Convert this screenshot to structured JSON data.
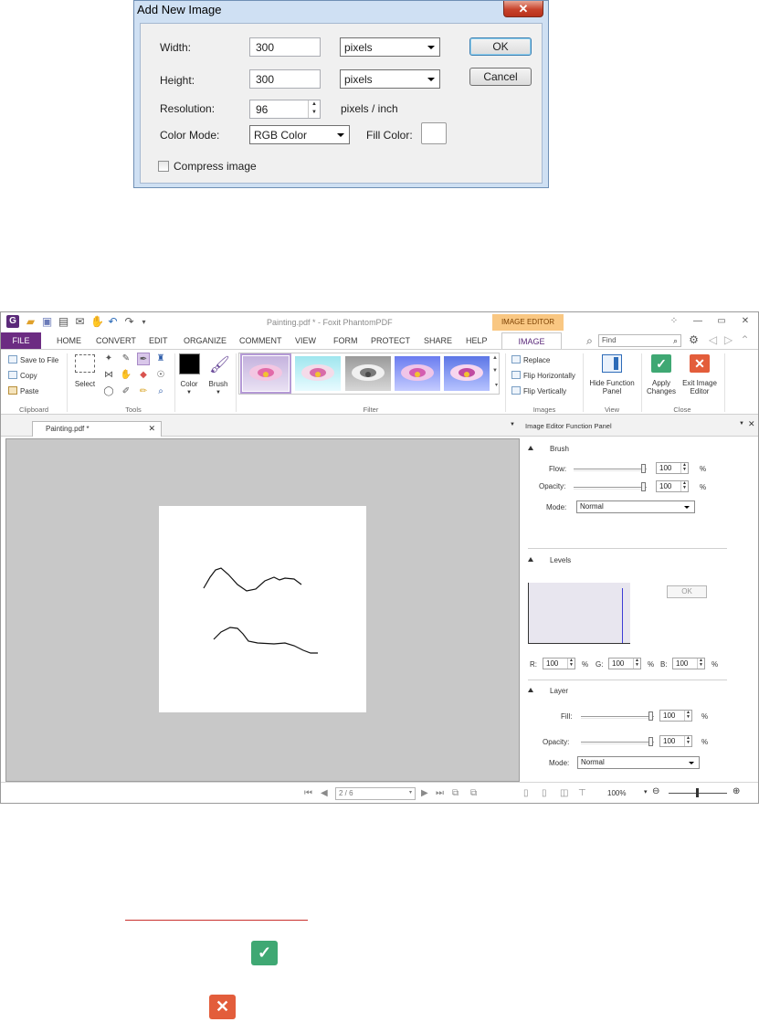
{
  "dialog": {
    "title": "Add New Image",
    "close_glyph": "✕",
    "width_label": "Width:",
    "width_value": "300",
    "width_unit": "pixels",
    "height_label": "Height:",
    "height_value": "300",
    "height_unit": "pixels",
    "resolution_label": "Resolution:",
    "resolution_value": "96",
    "resolution_unit": "pixels / inch",
    "color_mode_label": "Color Mode:",
    "color_mode_value": "RGB Color",
    "fill_color_label": "Fill Color:",
    "fill_color": "#ffffff",
    "compress_label": "Compress image",
    "compress_checked": false,
    "ok_label": "OK",
    "cancel_label": "Cancel"
  },
  "app": {
    "window_title": "Painting.pdf * - Foxit PhantomPDF",
    "context_tab_header": "IMAGE EDITOR",
    "tabs": [
      "FILE",
      "HOME",
      "CONVERT",
      "EDIT",
      "ORGANIZE",
      "COMMENT",
      "VIEW",
      "FORM",
      "PROTECT",
      "SHARE",
      "HELP",
      "IMAGE"
    ],
    "active_tab": "IMAGE",
    "find_placeholder": "Find",
    "ribbon": {
      "clipboard": {
        "label": "Clipboard",
        "save_to_file": "Save to File",
        "copy": "Copy",
        "paste": "Paste"
      },
      "tools": {
        "label": "Tools",
        "select": "Select"
      },
      "color_label": "Color",
      "brush_label": "Brush",
      "filter_label": "Filter",
      "images": {
        "label": "Images",
        "replace": "Replace",
        "flip_horizontally": "Flip Horizontally",
        "flip_vertically": "Flip Vertically"
      },
      "view": {
        "label": "View",
        "hide_function_panel_1": "Hide Function",
        "hide_function_panel_2": "Panel"
      },
      "close": {
        "label": "Close",
        "apply_1": "Apply",
        "apply_2": "Changes",
        "exit_1": "Exit Image",
        "exit_2": "Editor"
      }
    },
    "doc_tab": "Painting.pdf *",
    "panel_title": "Image Editor Function Panel",
    "brush": {
      "header": "Brush",
      "flow_label": "Flow:",
      "flow_value": "100",
      "opacity_label": "Opacity:",
      "opacity_value": "100",
      "mode_label": "Mode:",
      "mode_value": "Normal",
      "pct": "%"
    },
    "levels": {
      "header": "Levels",
      "ok_label": "OK",
      "r_label": "R:",
      "r_value": "100",
      "g_label": "G:",
      "g_value": "100",
      "b_label": "B:",
      "b_value": "100"
    },
    "layer": {
      "header": "Layer",
      "fill_label": "Fill:",
      "fill_value": "100",
      "opacity_label": "Opacity:",
      "opacity_value": "100",
      "mode_label": "Mode:",
      "mode_value": "Normal"
    },
    "status": {
      "page": "2 / 6",
      "zoom": "100%"
    }
  },
  "colors": {
    "apply_green": "#3fa873",
    "exit_red": "#e35d3b",
    "file_tab": "#6c2c82"
  },
  "icons": {
    "apply": "check-icon",
    "exit": "close-x-icon"
  }
}
